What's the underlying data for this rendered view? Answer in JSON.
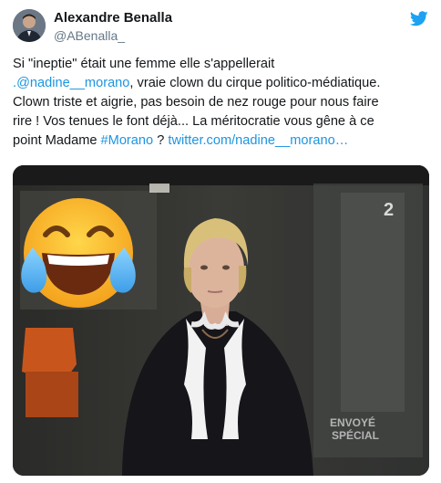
{
  "author": {
    "name": "Alexandre Benalla",
    "handle": "@ABenalla_"
  },
  "tweet": {
    "line1": "Si \"ineptie\" était une femme elle s'appellerait",
    "mention_prefix": ".",
    "mention": "@nadine__morano",
    "line2_rest": ", vraie clown du cirque politico-médiatique.",
    "line3": "Clown triste et aigrie, pas besoin de nez rouge pour nous faire",
    "line4": "rire ! Vos tenues le font déjà... La méritocratie vous gêne à ce",
    "line5_start": "point Madame ",
    "hashtag": "#Morano",
    "line5_mid": " ? ",
    "url": "twitter.com/nadine__morano…"
  },
  "media": {
    "channel_logo": "2",
    "watermark_line1": "ENVOYÉ",
    "watermark_line2": "SPÉCIAL",
    "sticker": "face-with-tears-of-joy-emoji"
  },
  "icons": {
    "brand": "twitter-bird-icon"
  },
  "colors": {
    "link": "#1b95e0",
    "twitter_blue": "#1da1f2",
    "handle_gray": "#657786",
    "text": "#14171a"
  }
}
